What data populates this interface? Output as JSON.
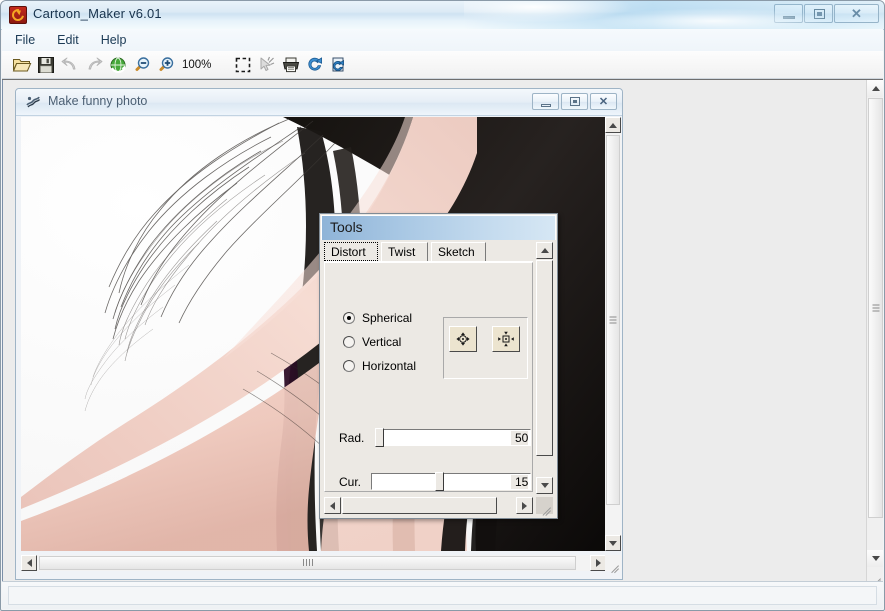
{
  "window": {
    "title": "Cartoon_Maker v6.01",
    "icon": "app-refresh-icon",
    "caption": {
      "minimize": "minimize-icon",
      "maximize": "maximize-icon",
      "close": "✕"
    }
  },
  "menubar": {
    "items": [
      {
        "label": "File"
      },
      {
        "label": "Edit"
      },
      {
        "label": "Help"
      }
    ]
  },
  "toolbar": {
    "zoom_level": "100%",
    "buttons": [
      {
        "name": "open-file-button",
        "icon": "folder-open-icon"
      },
      {
        "name": "save-file-button",
        "icon": "floppy-disk-icon"
      },
      {
        "name": "undo-button",
        "icon": "undo-arrow-icon"
      },
      {
        "name": "redo-button",
        "icon": "redo-arrow-icon"
      },
      {
        "name": "refresh-button",
        "icon": "globe-refresh-icon"
      },
      {
        "name": "zoom-out-button",
        "icon": "magnifier-minus-icon"
      },
      {
        "name": "zoom-in-button",
        "icon": "magnifier-plus-icon"
      },
      {
        "name": "select-region-button",
        "icon": "dashed-selection-icon"
      },
      {
        "name": "eyedropper-button",
        "icon": "wand-pointer-icon"
      },
      {
        "name": "print-button",
        "icon": "printer-icon"
      },
      {
        "name": "reload-button",
        "icon": "blue-refresh-icon"
      },
      {
        "name": "export-button",
        "icon": "blue-document-icon"
      }
    ]
  },
  "child_window": {
    "title": "Make funny photo",
    "icon": "photo-tool-icon",
    "caption": {
      "minimize": "minimize-icon",
      "maximize": "maximize-icon",
      "close": "✕"
    }
  },
  "tools_panel": {
    "title": "Tools",
    "tabs": [
      {
        "label": "Distort",
        "selected": true
      },
      {
        "label": "Twist",
        "selected": false
      },
      {
        "label": "Sketch",
        "selected": false
      }
    ],
    "distort": {
      "radios": [
        {
          "label": "Spherical",
          "checked": true
        },
        {
          "label": "Vertical",
          "checked": false
        },
        {
          "label": "Horizontal",
          "checked": false
        }
      ],
      "icon_buttons": [
        {
          "name": "expand-outward-button",
          "icon": "arrows-outward-icon"
        },
        {
          "name": "contract-inward-button",
          "icon": "arrows-inward-icon"
        }
      ],
      "sliders": [
        {
          "label": "Rad.",
          "value": "50",
          "fraction": 0.045
        },
        {
          "label": "Cur.",
          "value": "15",
          "fraction": 0.5
        }
      ]
    }
  },
  "colors": {
    "titlebar_text": "#18334d",
    "tools_header_start": "#8fb4d8",
    "tools_header_end": "#d6e7f4",
    "panel_face": "#ece9e4",
    "mdi_background": "#ececec"
  }
}
